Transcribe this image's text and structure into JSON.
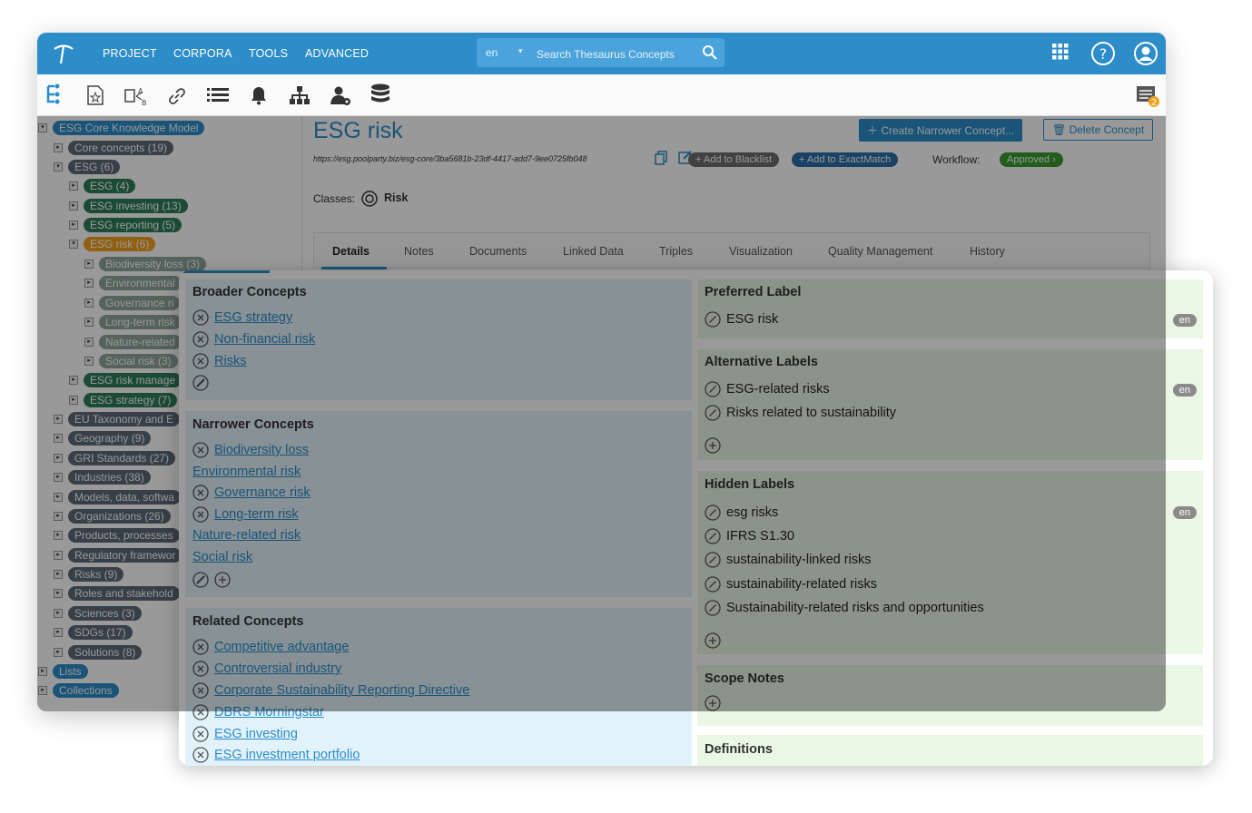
{
  "topbar": {
    "menu": [
      "PROJECT",
      "CORPORA",
      "TOOLS",
      "ADVANCED"
    ],
    "search_lang": "en",
    "search_placeholder": "Search Thesaurus Concepts",
    "notif_count": "2"
  },
  "tree": {
    "root": "ESG Core Knowledge Model",
    "items": [
      "Core concepts (19)",
      "ESG (6)",
      "ESG (4)",
      "ESG investing (13)",
      "ESG reporting (5)",
      "ESG risk (6)",
      "Biodiversity loss (3)",
      "Environmental",
      "Governance ri",
      "Long-term risk",
      "Nature-related",
      "Social risk (3)",
      "ESG risk manage",
      "ESG strategy (7)",
      "EU Taxonomy and E",
      "Geography (9)",
      "GRI Standards (27)",
      "Industries (38)",
      "Models, data, softwa",
      "Organizations (26)",
      "Products, processes",
      "Regulatory framewor",
      "Risks (9)",
      "Roles and stakehold",
      "Sciences (3)",
      "SDGs (17)",
      "Solutions (8)"
    ],
    "bottom": [
      "Lists",
      "Collections"
    ]
  },
  "concept": {
    "title": "ESG risk",
    "create_btn": "Create Narrower Concept...",
    "delete_btn": "Delete Concept",
    "uri": "https://esg.poolparty.biz/esg-core/3ba5681b-23df-4417-add7-9ee0725fb048",
    "blacklist_btn": "+ Add to Blacklist",
    "exactmatch_btn": "+ Add to ExactMatch",
    "workflow_label": "Workflow:",
    "workflow_status": "Approved",
    "classes_label": "Classes:",
    "class_value": "Risk",
    "tabs": [
      "Details",
      "Notes",
      "Documents",
      "Linked Data",
      "Triples",
      "Visualization",
      "Quality Management",
      "History"
    ]
  },
  "broader": {
    "title": "Broader Concepts",
    "items": [
      "ESG strategy",
      "Non-financial risk",
      "Risks"
    ]
  },
  "narrower": {
    "title": "Narrower Concepts",
    "items": [
      {
        "label": "Biodiversity loss"
      },
      {
        "label": "Environmental risk"
      },
      {
        "label": "Governance risk"
      },
      {
        "label": "Long-term risk"
      },
      {
        "label": "Nature-related risk"
      },
      {
        "label": "Social risk"
      }
    ]
  },
  "related": {
    "title": "Related Concepts",
    "items": [
      "Competitive advantage",
      "Controversial industry",
      "Corporate Sustainability Reporting Directive",
      "DBRS Morningstar",
      "ESG investing",
      "ESG investment portfolio"
    ]
  },
  "preferred": {
    "title": "Preferred Label",
    "value": "ESG risk",
    "lang": "en"
  },
  "alternative": {
    "title": "Alternative Labels",
    "items": [
      "ESG-related risks",
      "Risks related to sustainability"
    ],
    "lang": "en"
  },
  "hidden": {
    "title": "Hidden Labels",
    "items": [
      "esg risks",
      "IFRS S1.30",
      "sustainability-linked risks",
      "sustainability-related risks",
      "Sustainability-related risks and opportunities"
    ],
    "lang": "en"
  },
  "scope": {
    "title": "Scope Notes"
  },
  "definitions": {
    "title": "Definitions"
  }
}
